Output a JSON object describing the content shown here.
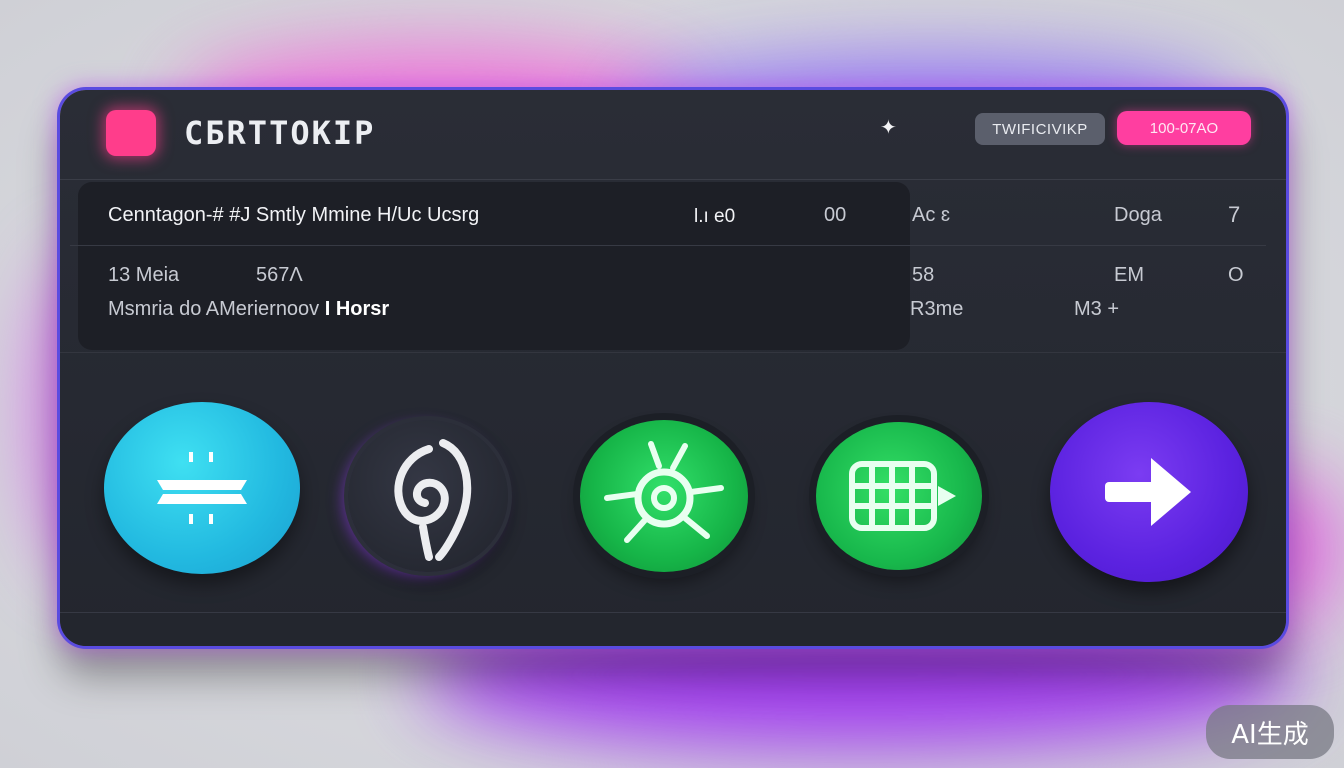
{
  "header": {
    "app_title": "CБRTTOKIP",
    "pill_secondary": "TWIFICIVIKP",
    "pill_primary": "100-07AO"
  },
  "rows": [
    {
      "left_text": "Cenntagon-# #J Smtly Mmine H/Uc Ucsrg",
      "mid_value": "l.ı e0",
      "mid_value_2": "00",
      "col_3": "Ac ɛ",
      "col_4": "Doga",
      "col_5": "7"
    },
    {
      "left_text": "13 Meia",
      "left_value": "567Λ",
      "col_3": "58",
      "col_4": "EM",
      "col_5": "O"
    },
    {
      "left_text": "Msmria do AMeriernoov",
      "left_bold": "I Horsr",
      "col_3": "R3me",
      "col_4": "M3 +"
    }
  ],
  "actions": [
    {
      "name": "menu",
      "icon": "menu-icon",
      "color": "#22b9e0"
    },
    {
      "name": "spiral",
      "icon": "spiral-icon",
      "color": "#20232b"
    },
    {
      "name": "bug",
      "icon": "bug-icon",
      "color": "#16b548"
    },
    {
      "name": "grid",
      "icon": "grid-icon",
      "color": "#18b84c"
    },
    {
      "name": "next",
      "icon": "arrow-right-icon",
      "color": "#5b22e0"
    }
  ],
  "watermark": "AI生成"
}
